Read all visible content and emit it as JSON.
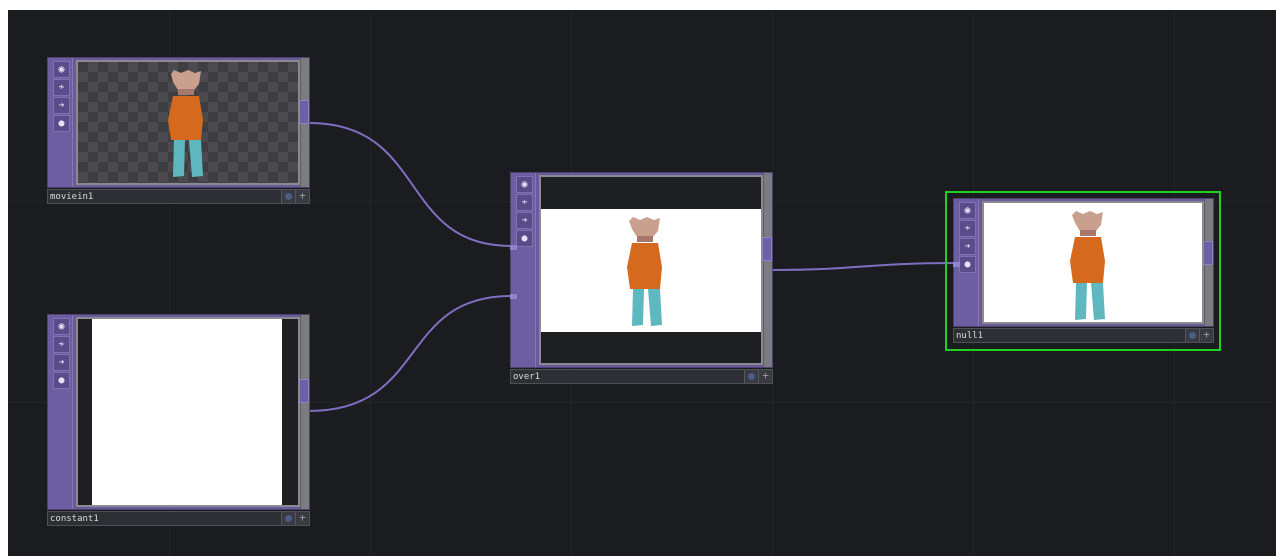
{
  "colors": {
    "background": "#1b1c20",
    "node_strip": "#6d5ea1",
    "wire": "#7e6fc0",
    "selected_outline": "#1fd11f"
  },
  "nodes": [
    {
      "id": "moviein1",
      "label": "moviein1",
      "preview": "figure on transparency"
    },
    {
      "id": "constant1",
      "label": "constant1",
      "preview": "white constant"
    },
    {
      "id": "over1",
      "label": "over1",
      "preview": "figure over white"
    },
    {
      "id": "null1",
      "label": "null1",
      "preview": "figure over white",
      "selected": true
    }
  ],
  "node_buttons": [
    "viewer-toggle-icon",
    "bypass-icon",
    "cook-icon",
    "lock-icon"
  ],
  "connections": [
    {
      "from": "moviein1",
      "to": "over1"
    },
    {
      "from": "constant1",
      "to": "over1"
    },
    {
      "from": "over1",
      "to": "null1"
    }
  ]
}
